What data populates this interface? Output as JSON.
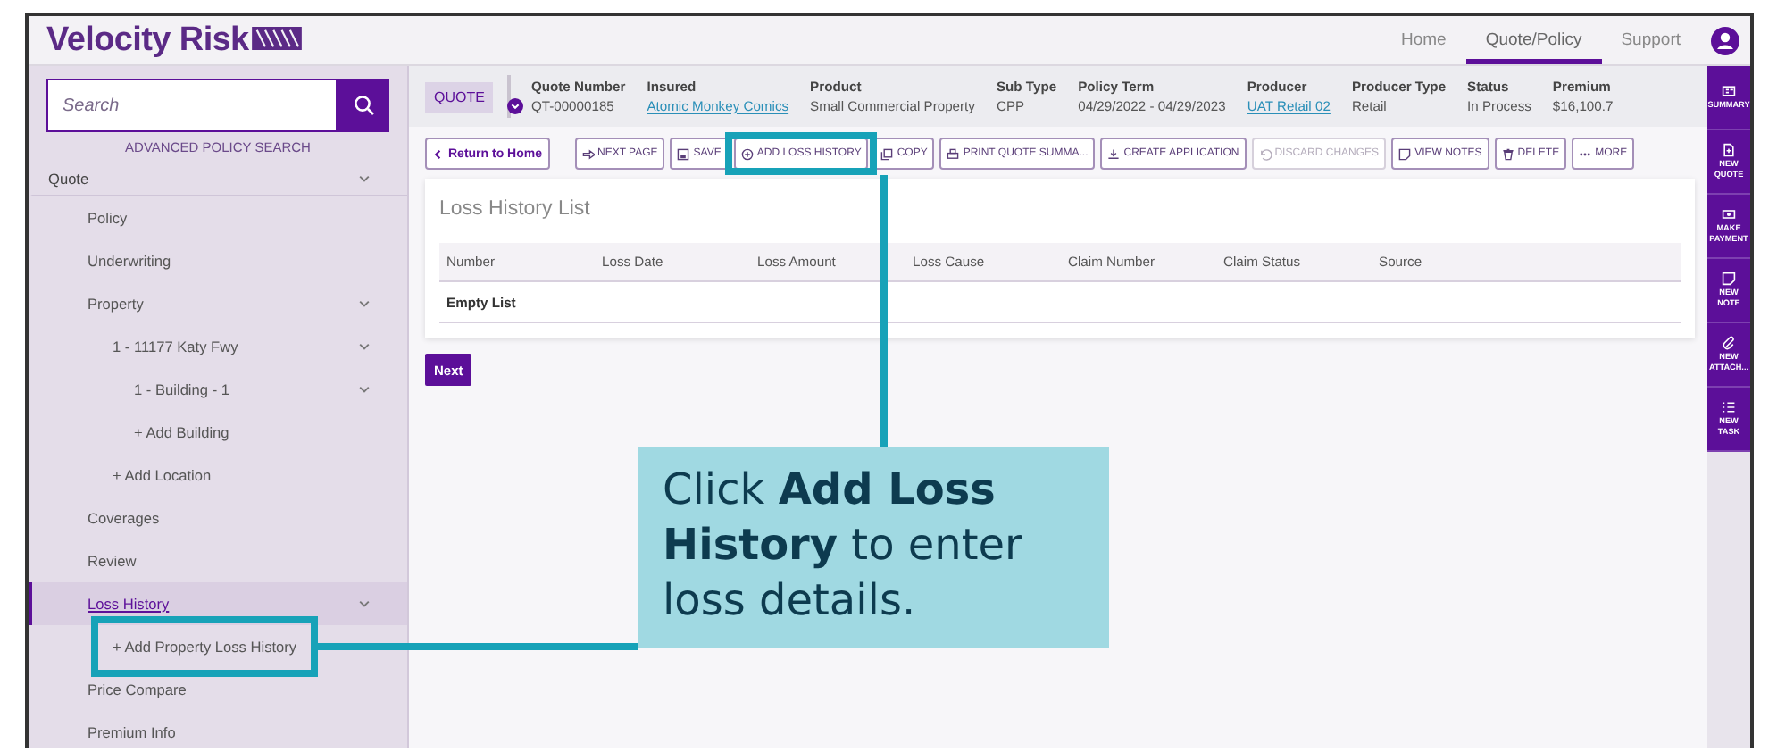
{
  "top_bar": {
    "logo": "Velocity Risk",
    "nav": [
      {
        "label": "Home",
        "selected": false
      },
      {
        "label": "Quote/Policy",
        "selected": true
      },
      {
        "label": "Support",
        "selected": false
      }
    ]
  },
  "sidebar": {
    "search": {
      "placeholder": "Search"
    },
    "advanced_link": "ADVANCED POLICY SEARCH",
    "items": [
      {
        "label": "Quote",
        "expanded": true,
        "selected": false,
        "children": [
          {
            "label": "Policy",
            "selected": false
          },
          {
            "label": "Underwriting",
            "selected": false
          },
          {
            "label": "Property",
            "expanded": true,
            "selected": false,
            "children": [
              {
                "label": "1 - 11177 Katy Fwy",
                "expanded": true,
                "selected": false,
                "children": [
                  {
                    "label": "1 - Building - 1",
                    "expanded": true,
                    "selected": false
                  },
                  {
                    "label": "+ Add Building",
                    "selected": false
                  }
                ]
              },
              {
                "label": "+ Add Location",
                "selected": false
              }
            ]
          },
          {
            "label": "Coverages",
            "selected": false
          },
          {
            "label": "Review",
            "selected": false
          },
          {
            "label": "Loss History",
            "expanded": true,
            "selected": true,
            "children": [
              {
                "label": "+ Add Property Loss History",
                "selected": false,
                "highlighted": true
              }
            ]
          },
          {
            "label": "Price Compare",
            "selected": false
          },
          {
            "label": "Premium Info",
            "selected": false
          }
        ]
      }
    ]
  },
  "quote_header": {
    "badge": "QUOTE",
    "fields": [
      {
        "label": "Quote Number",
        "value": "QT-00000185",
        "link": false
      },
      {
        "label": "Insured",
        "value": "Atomic Monkey Comics",
        "link": true
      },
      {
        "label": "Product",
        "value": "Small Commercial Property",
        "link": false
      },
      {
        "label": "Sub Type",
        "value": "CPP",
        "link": false
      },
      {
        "label": "Policy Term",
        "value": "04/29/2022 - 04/29/2023",
        "link": false
      },
      {
        "label": "Producer",
        "value": "UAT Retail 02",
        "link": true
      },
      {
        "label": "Producer Type",
        "value": "Retail",
        "link": false
      },
      {
        "label": "Status",
        "value": "In Process",
        "link": false
      },
      {
        "label": "Premium",
        "value": "$16,100.7",
        "link": false
      }
    ]
  },
  "toolbar": {
    "back": {
      "label": "Return to Home"
    },
    "buttons": [
      {
        "label": "NEXT PAGE",
        "kind": "arrow",
        "disabled": false,
        "highlighted": false
      },
      {
        "label": "SAVE",
        "kind": "save",
        "disabled": false,
        "highlighted": false
      },
      {
        "label": "ADD LOSS HISTORY",
        "kind": "plus",
        "disabled": false,
        "highlighted": true
      },
      {
        "label": "COPY",
        "kind": "copy",
        "disabled": false,
        "highlighted": false
      },
      {
        "label": "PRINT QUOTE SUMMA...",
        "kind": "print",
        "disabled": false,
        "highlighted": false
      },
      {
        "label": "CREATE APPLICATION",
        "kind": "download",
        "disabled": false,
        "highlighted": false
      },
      {
        "label": "DISCARD CHANGES",
        "kind": "undo",
        "disabled": true,
        "highlighted": false
      },
      {
        "label": "VIEW NOTES",
        "kind": "note",
        "disabled": false,
        "highlighted": false
      },
      {
        "label": "DELETE",
        "kind": "trash",
        "disabled": false,
        "highlighted": false
      },
      {
        "label": "MORE",
        "kind": "dots",
        "disabled": false,
        "highlighted": false
      }
    ]
  },
  "loss_history": {
    "title": "Loss History List",
    "columns": [
      "Number",
      "Loss Date",
      "Loss Amount",
      "Loss Cause",
      "Claim Number",
      "Claim Status",
      "Source"
    ],
    "empty_text": "Empty List"
  },
  "next_button": "Next",
  "right_rail": [
    {
      "label": "SUMMARY",
      "kind": "card"
    },
    {
      "label": "NEW QUOTE",
      "kind": "doc"
    },
    {
      "label": "MAKE PAYMENT",
      "kind": "money"
    },
    {
      "label": "NEW NOTE",
      "kind": "note"
    },
    {
      "label": "NEW ATTACH...",
      "kind": "clip"
    },
    {
      "label": "NEW TASK",
      "kind": "list"
    }
  ],
  "callout": {
    "text": "Click **Add Loss History** to enter loss details."
  }
}
